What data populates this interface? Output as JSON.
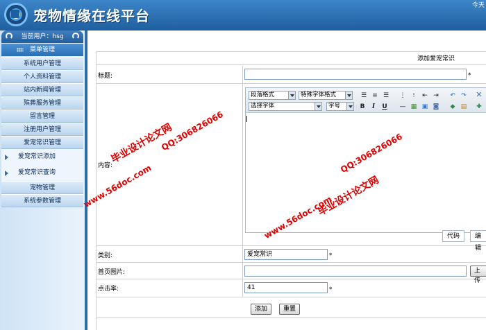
{
  "header": {
    "title": "宠物情缘在线平台",
    "today": "今天"
  },
  "sidebar": {
    "current_user": "当前用户：hsg",
    "menu_head": "菜单管理",
    "items": [
      {
        "label": "系统用户管理"
      },
      {
        "label": "个人资料管理"
      },
      {
        "label": "站内新闻管理"
      },
      {
        "label": "殡葬服务管理"
      },
      {
        "label": "留言管理"
      },
      {
        "label": "注册用户管理"
      },
      {
        "label": "爱宠常识管理"
      }
    ],
    "sub_items": [
      {
        "label": "爱宠常识添加"
      },
      {
        "label": "爱宠常识查询"
      }
    ],
    "items_after": [
      {
        "label": "宠物管理"
      },
      {
        "label": "系统参数管理"
      }
    ]
  },
  "form": {
    "title": "添加爱宠常识",
    "fields": {
      "title_label": "标题:",
      "content_label": "内容:",
      "category_label": "类别:",
      "category_value": "爱宠常识",
      "image_label": "首页图片:",
      "upload_label": "上传",
      "clicks_label": "点击率:",
      "clicks_value": "41",
      "required_mark": "*"
    },
    "editor": {
      "paragraph_format": "段落格式",
      "special_font_format": "特殊字体格式",
      "select_font": "选择字体",
      "font_size": "字号",
      "bold": "B",
      "italic": "I",
      "underline": "U",
      "tab_code": "代码",
      "tab_edit": "编辑"
    },
    "buttons": {
      "add": "添加",
      "reset": "重置"
    }
  },
  "watermarks": {
    "site_name": "毕业设计论文网",
    "qq": "QQ:306826066",
    "url": "www.56doc.com"
  }
}
